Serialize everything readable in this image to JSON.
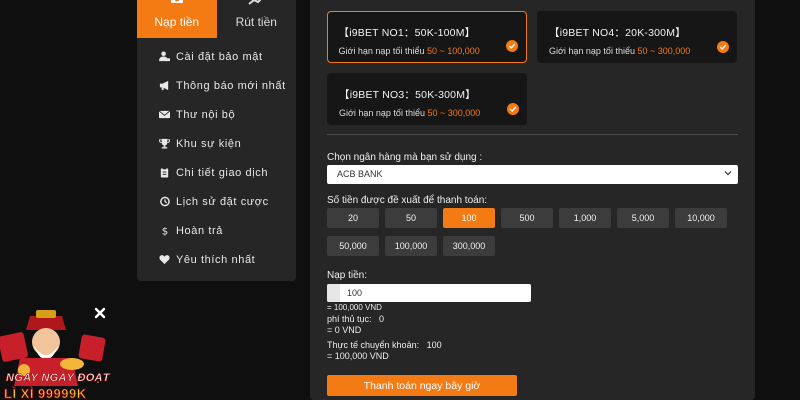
{
  "sidebar": {
    "tabs": [
      {
        "label": "Nạp tiền",
        "icon": "deposit-icon",
        "active": true
      },
      {
        "label": "Rút tiền",
        "icon": "withdraw-icon",
        "active": false
      }
    ],
    "items": [
      {
        "label": "Cài đặt bảo mật",
        "icon": "user-lock-icon"
      },
      {
        "label": "Thông báo mới nhất",
        "icon": "megaphone-icon"
      },
      {
        "label": "Thư nội bộ",
        "icon": "envelope-icon"
      },
      {
        "label": "Khu sự kiện",
        "icon": "trophy-icon"
      },
      {
        "label": "Chi tiết giao dịch",
        "icon": "clipboard-icon"
      },
      {
        "label": "Lịch sử đặt cược",
        "icon": "history-icon"
      },
      {
        "label": "Hoàn trả",
        "icon": "dollar-icon"
      },
      {
        "label": "Yêu thích nhất",
        "icon": "heart-icon"
      }
    ]
  },
  "channels": [
    {
      "title": "【i9BET NO1：50K-100M】",
      "limit_label": "Giới hạn nạp tối thiểu",
      "range": "50 ~ 100,000",
      "selected": true
    },
    {
      "title": "【i9BET NO4：20K-300M】",
      "limit_label": "Giới hạn nạp tối thiểu",
      "range": "50 ~ 300,000",
      "selected": false
    },
    {
      "title": "【i9BET NO3：50K-300M】",
      "limit_label": "Giới hạn nạp tối thiểu",
      "range": "50 ~ 300,000",
      "selected": false
    }
  ],
  "bank": {
    "label": "Chọn ngân hàng mà bạn sử dụng :",
    "selected": "ACB BANK"
  },
  "amounts": {
    "label": "Số tiền được đề xuất để thanh toán:",
    "options": [
      "20",
      "50",
      "100",
      "500",
      "1,000",
      "5,000",
      "10,000",
      "50,000",
      "100,000",
      "300,000"
    ],
    "selected": "100"
  },
  "deposit": {
    "label": "Nạp tiền:",
    "value": "100",
    "converted": "= 100,000 VND",
    "fee_label": "phí thủ tục:",
    "fee_value": "0",
    "fee_converted": "= 0 VND",
    "actual_label": "Thực tế chuyển khoản:",
    "actual_value": "100",
    "actual_converted": "= 100,000 VND"
  },
  "pay_button": "Thanh toán ngay bây giờ",
  "promo": {
    "line1": "NGAY NGÀY ĐOẠT",
    "line2": "LÌ XÌ 99999K"
  },
  "colors": {
    "accent": "#f47a13",
    "panel": "#262626",
    "card": "#161616",
    "background": "#0f0f0f"
  }
}
